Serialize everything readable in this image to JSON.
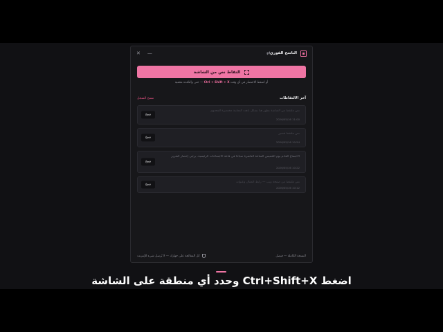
{
  "window": {
    "title": "الناسخ الفوري",
    "minimize_glyph": "—",
    "close_glyph": "✕",
    "swap_glyph": "⇄"
  },
  "capture": {
    "label": "التقاط نص من الشاشة"
  },
  "hint": {
    "prefix": "أو اضغط الاختصار في أي وقت",
    "shortcut": "Ctrl + Shift + X",
    "suffix": "— حتى والنافذة مخفية"
  },
  "history": {
    "title": "آخر الالتقاطات",
    "clear_label": "مسح السجل",
    "items": [
      {
        "text": "نص ملتقط من الشاشة يظهر هنا بشكل باهت كمعاينة مختصرة للمحتوى",
        "time": "2026/05/16 11:00",
        "copy_label": "نسخ"
      },
      {
        "text": "نص ملتقط قصير",
        "time": "2026/05/16 10:54",
        "copy_label": "نسخ"
      },
      {
        "text": "الاجتماع القادم يوم الخميس الساعة العاشرة صباحاً في قاعة الاجتماعات الرئيسية. يرجى إحضار التقرير",
        "time": "2026/05/16 10:22",
        "copy_label": "نسخ"
      },
      {
        "text": "نص ملتقط من صفحة ويب — رابط المقال وعنوانه",
        "time": "2026/05/16 10:12",
        "copy_label": "نسخ"
      }
    ]
  },
  "footer": {
    "left": "النسخة الكاملة — فيصل",
    "right": "كل المعالجة على جهازك — لا يُرسل شيء للإنترنت"
  },
  "caption": "اضغط Ctrl+Shift+X وحدد أي منطقة على الشاشة",
  "colors": {
    "accent": "#ef75a4",
    "background": "#17171a"
  }
}
